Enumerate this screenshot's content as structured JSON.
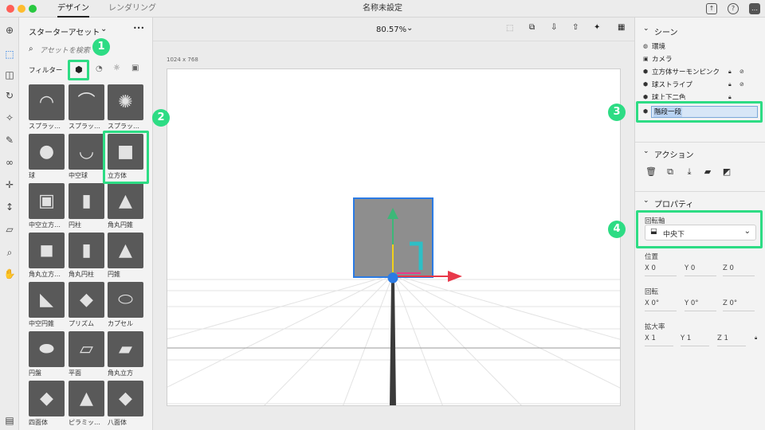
{
  "titlebar": {
    "window_title": "名称未設定",
    "tabs": [
      {
        "label": "デザイン"
      },
      {
        "label": "レンダリング"
      }
    ],
    "colors": {
      "close": "#ff5f57",
      "minimize": "#febc2e",
      "zoom": "#28c840"
    }
  },
  "assets": {
    "title": "スターターアセット",
    "more": "•••",
    "search_placeholder": "アセットを検索",
    "filter_label": "フィルター",
    "items": [
      {
        "label": "スプラッ…"
      },
      {
        "label": "スプラッ…"
      },
      {
        "label": "スプラッ…"
      },
      {
        "label": "球"
      },
      {
        "label": "中空球"
      },
      {
        "label": "立方体"
      },
      {
        "label": "中空立方…"
      },
      {
        "label": "円柱"
      },
      {
        "label": "角丸円錐"
      },
      {
        "label": "角丸立方…"
      },
      {
        "label": "角丸円柱"
      },
      {
        "label": "円錐"
      },
      {
        "label": "中空円錐"
      },
      {
        "label": "プリズム"
      },
      {
        "label": "カプセル"
      },
      {
        "label": "円盤"
      },
      {
        "label": "平面"
      },
      {
        "label": "角丸立方"
      },
      {
        "label": "四面体"
      },
      {
        "label": "ピラミッ…"
      },
      {
        "label": "八面体"
      }
    ]
  },
  "canvas": {
    "zoom": "80.57%",
    "size_label": "1024 x 768"
  },
  "scene": {
    "title": "シーン",
    "items": [
      {
        "label": "環境"
      },
      {
        "label": "カメラ"
      },
      {
        "label": "立方体サーモンピンク"
      },
      {
        "label": "球ストライプ"
      },
      {
        "label": "球上下二色"
      }
    ],
    "editing_value": "階段一段"
  },
  "actions": {
    "title": "アクション"
  },
  "properties": {
    "title": "プロパティ",
    "pivot_label": "回転軸",
    "pivot_value": "中央下",
    "position_label": "位置",
    "position": {
      "x": "X 0",
      "y": "Y 0",
      "z": "Z 0"
    },
    "rotation_label": "回転",
    "rotation": {
      "x": "X 0°",
      "y": "Y 0°",
      "z": "Z 0°"
    },
    "scale_label": "拡大率",
    "scale": {
      "x": "X 1",
      "y": "Y 1",
      "z": "Z 1"
    }
  },
  "callouts": {
    "n1": "1",
    "n2": "2",
    "n3": "3",
    "n4": "4",
    "color": "#2ddc84"
  },
  "gizmo_colors": {
    "x": "#e8394a",
    "y": "#3cb878",
    "z": "#2ebfc6",
    "pivot": "#2b7be4"
  }
}
